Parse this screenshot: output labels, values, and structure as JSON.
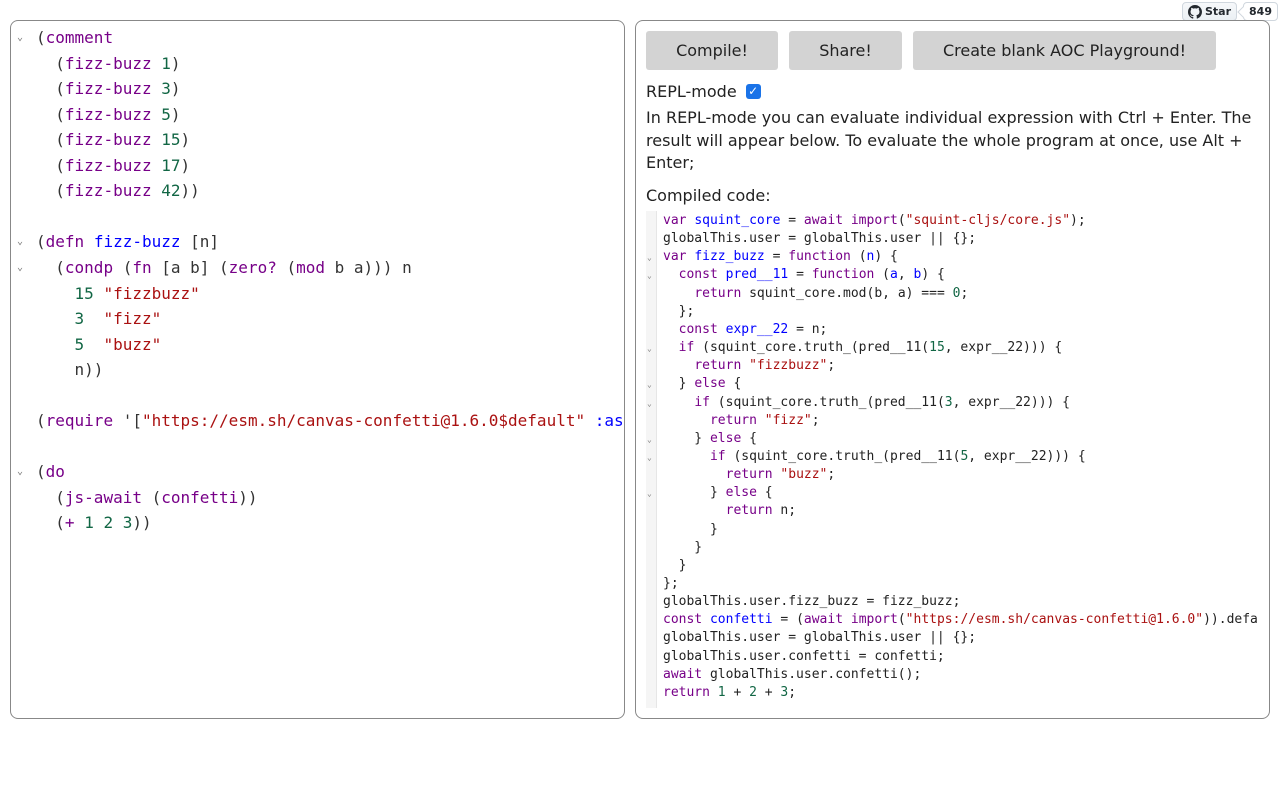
{
  "github": {
    "star_label": "Star",
    "star_count": "849"
  },
  "toolbar": {
    "compile_label": "Compile!",
    "share_label": "Share!",
    "aoc_label": "Create blank AOC Playground!"
  },
  "repl": {
    "label": "REPL-mode",
    "checked": true,
    "help_text": "In REPL-mode you can evaluate individual expression with Ctrl + Enter. The result will appear below. To evaluate the whole program at once, use Alt + Enter;"
  },
  "compiled_label": "Compiled code:",
  "source_lines": [
    {
      "fold": true,
      "tokens": [
        [
          "(",
          "paren"
        ],
        [
          "comment",
          "fn"
        ]
      ]
    },
    {
      "fold": false,
      "tokens": [
        [
          "  (",
          "paren"
        ],
        [
          "fizz-buzz",
          "fn"
        ],
        [
          " ",
          "plain"
        ],
        [
          "1",
          "num"
        ],
        [
          ")",
          "paren"
        ]
      ]
    },
    {
      "fold": false,
      "tokens": [
        [
          "  (",
          "paren"
        ],
        [
          "fizz-buzz",
          "fn"
        ],
        [
          " ",
          "plain"
        ],
        [
          "3",
          "num"
        ],
        [
          ")",
          "paren"
        ]
      ]
    },
    {
      "fold": false,
      "tokens": [
        [
          "  (",
          "paren"
        ],
        [
          "fizz-buzz",
          "fn"
        ],
        [
          " ",
          "plain"
        ],
        [
          "5",
          "num"
        ],
        [
          ")",
          "paren"
        ]
      ]
    },
    {
      "fold": false,
      "tokens": [
        [
          "  (",
          "paren"
        ],
        [
          "fizz-buzz",
          "fn"
        ],
        [
          " ",
          "plain"
        ],
        [
          "15",
          "num"
        ],
        [
          ")",
          "paren"
        ]
      ]
    },
    {
      "fold": false,
      "tokens": [
        [
          "  (",
          "paren"
        ],
        [
          "fizz-buzz",
          "fn"
        ],
        [
          " ",
          "plain"
        ],
        [
          "17",
          "num"
        ],
        [
          ")",
          "paren"
        ]
      ]
    },
    {
      "fold": false,
      "tokens": [
        [
          "  (",
          "paren"
        ],
        [
          "fizz-buzz",
          "fn"
        ],
        [
          " ",
          "plain"
        ],
        [
          "42",
          "num"
        ],
        [
          "))",
          "paren"
        ]
      ]
    },
    {
      "fold": false,
      "tokens": []
    },
    {
      "fold": true,
      "tokens": [
        [
          "(",
          "paren"
        ],
        [
          "defn",
          "fn"
        ],
        [
          " ",
          "plain"
        ],
        [
          "fizz-buzz",
          "def"
        ],
        [
          " [n]",
          "sym"
        ]
      ]
    },
    {
      "fold": true,
      "tokens": [
        [
          "  (",
          "paren"
        ],
        [
          "condp",
          "fn"
        ],
        [
          " (",
          "paren"
        ],
        [
          "fn",
          "fn"
        ],
        [
          " [a b] (",
          "sym"
        ],
        [
          "zero?",
          "fn"
        ],
        [
          " (",
          "paren"
        ],
        [
          "mod",
          "fn"
        ],
        [
          " b a))) n",
          "sym"
        ]
      ]
    },
    {
      "fold": false,
      "tokens": [
        [
          "    ",
          "plain"
        ],
        [
          "15",
          "num"
        ],
        [
          " ",
          "plain"
        ],
        [
          "\"fizzbuzz\"",
          "str"
        ]
      ]
    },
    {
      "fold": false,
      "tokens": [
        [
          "    ",
          "plain"
        ],
        [
          "3",
          "num"
        ],
        [
          "  ",
          "plain"
        ],
        [
          "\"fizz\"",
          "str"
        ]
      ]
    },
    {
      "fold": false,
      "tokens": [
        [
          "    ",
          "plain"
        ],
        [
          "5",
          "num"
        ],
        [
          "  ",
          "plain"
        ],
        [
          "\"buzz\"",
          "str"
        ]
      ]
    },
    {
      "fold": false,
      "tokens": [
        [
          "    n))",
          "sym"
        ]
      ]
    },
    {
      "fold": false,
      "tokens": []
    },
    {
      "fold": false,
      "tokens": [
        [
          "(",
          "paren"
        ],
        [
          "require",
          "fn"
        ],
        [
          " '[",
          "sym"
        ],
        [
          "\"https://esm.sh/canvas-confetti@1.6.0$default\"",
          "str"
        ],
        [
          " ",
          "plain"
        ],
        [
          ":as",
          "var"
        ]
      ]
    },
    {
      "fold": false,
      "tokens": []
    },
    {
      "fold": true,
      "tokens": [
        [
          "(",
          "paren"
        ],
        [
          "do",
          "fn"
        ]
      ]
    },
    {
      "fold": false,
      "tokens": [
        [
          "  (",
          "paren"
        ],
        [
          "js-await",
          "fn"
        ],
        [
          " (",
          "paren"
        ],
        [
          "confetti",
          "fn"
        ],
        [
          "))",
          "paren"
        ]
      ]
    },
    {
      "fold": false,
      "tokens": [
        [
          "  (",
          "paren"
        ],
        [
          "+",
          "fn"
        ],
        [
          " ",
          "plain"
        ],
        [
          "1",
          "num"
        ],
        [
          " ",
          "plain"
        ],
        [
          "2",
          "num"
        ],
        [
          " ",
          "plain"
        ],
        [
          "3",
          "num"
        ],
        [
          "))",
          "paren"
        ]
      ]
    }
  ],
  "compiled_lines": [
    {
      "fold": false,
      "tokens": [
        [
          "var",
          "kw"
        ],
        [
          " ",
          "plain"
        ],
        [
          "squint_core",
          "var"
        ],
        [
          " = ",
          "plain"
        ],
        [
          "await",
          "kw"
        ],
        [
          " ",
          "plain"
        ],
        [
          "import",
          "kw"
        ],
        [
          "(",
          "plain"
        ],
        [
          "\"squint-cljs/core.js\"",
          "str"
        ],
        [
          ");",
          "plain"
        ]
      ]
    },
    {
      "fold": false,
      "tokens": [
        [
          "globalThis.user = globalThis.user || {};",
          "plain"
        ]
      ]
    },
    {
      "fold": true,
      "tokens": [
        [
          "var",
          "kw"
        ],
        [
          " ",
          "plain"
        ],
        [
          "fizz_buzz",
          "var"
        ],
        [
          " = ",
          "plain"
        ],
        [
          "function",
          "kw"
        ],
        [
          " (",
          "plain"
        ],
        [
          "n",
          "var"
        ],
        [
          ") {",
          "plain"
        ]
      ]
    },
    {
      "fold": true,
      "tokens": [
        [
          "  ",
          "plain"
        ],
        [
          "const",
          "kw"
        ],
        [
          " ",
          "plain"
        ],
        [
          "pred__11",
          "var"
        ],
        [
          " = ",
          "plain"
        ],
        [
          "function",
          "kw"
        ],
        [
          " (",
          "plain"
        ],
        [
          "a",
          "var"
        ],
        [
          ", ",
          "plain"
        ],
        [
          "b",
          "var"
        ],
        [
          ") {",
          "plain"
        ]
      ]
    },
    {
      "fold": false,
      "tokens": [
        [
          "    ",
          "plain"
        ],
        [
          "return",
          "kw"
        ],
        [
          " squint_core.mod(b, a) === ",
          "plain"
        ],
        [
          "0",
          "num"
        ],
        [
          ";",
          "plain"
        ]
      ]
    },
    {
      "fold": false,
      "tokens": [
        [
          "  };",
          "plain"
        ]
      ]
    },
    {
      "fold": false,
      "tokens": [
        [
          "  ",
          "plain"
        ],
        [
          "const",
          "kw"
        ],
        [
          " ",
          "plain"
        ],
        [
          "expr__22",
          "var"
        ],
        [
          " = n;",
          "plain"
        ]
      ]
    },
    {
      "fold": true,
      "tokens": [
        [
          "  ",
          "plain"
        ],
        [
          "if",
          "kw"
        ],
        [
          " (squint_core.truth_(pred__11(",
          "plain"
        ],
        [
          "15",
          "num"
        ],
        [
          ", expr__22))) {",
          "plain"
        ]
      ]
    },
    {
      "fold": false,
      "tokens": [
        [
          "    ",
          "plain"
        ],
        [
          "return",
          "kw"
        ],
        [
          " ",
          "plain"
        ],
        [
          "\"fizzbuzz\"",
          "str"
        ],
        [
          ";",
          "plain"
        ]
      ]
    },
    {
      "fold": true,
      "tokens": [
        [
          "  } ",
          "plain"
        ],
        [
          "else",
          "kw"
        ],
        [
          " {",
          "plain"
        ]
      ]
    },
    {
      "fold": true,
      "tokens": [
        [
          "    ",
          "plain"
        ],
        [
          "if",
          "kw"
        ],
        [
          " (squint_core.truth_(pred__11(",
          "plain"
        ],
        [
          "3",
          "num"
        ],
        [
          ", expr__22))) {",
          "plain"
        ]
      ]
    },
    {
      "fold": false,
      "tokens": [
        [
          "      ",
          "plain"
        ],
        [
          "return",
          "kw"
        ],
        [
          " ",
          "plain"
        ],
        [
          "\"fizz\"",
          "str"
        ],
        [
          ";",
          "plain"
        ]
      ]
    },
    {
      "fold": true,
      "tokens": [
        [
          "    } ",
          "plain"
        ],
        [
          "else",
          "kw"
        ],
        [
          " {",
          "plain"
        ]
      ]
    },
    {
      "fold": true,
      "tokens": [
        [
          "      ",
          "plain"
        ],
        [
          "if",
          "kw"
        ],
        [
          " (squint_core.truth_(pred__11(",
          "plain"
        ],
        [
          "5",
          "num"
        ],
        [
          ", expr__22))) {",
          "plain"
        ]
      ]
    },
    {
      "fold": false,
      "tokens": [
        [
          "        ",
          "plain"
        ],
        [
          "return",
          "kw"
        ],
        [
          " ",
          "plain"
        ],
        [
          "\"buzz\"",
          "str"
        ],
        [
          ";",
          "plain"
        ]
      ]
    },
    {
      "fold": true,
      "tokens": [
        [
          "      } ",
          "plain"
        ],
        [
          "else",
          "kw"
        ],
        [
          " {",
          "plain"
        ]
      ]
    },
    {
      "fold": false,
      "tokens": [
        [
          "        ",
          "plain"
        ],
        [
          "return",
          "kw"
        ],
        [
          " n;",
          "plain"
        ]
      ]
    },
    {
      "fold": false,
      "tokens": [
        [
          "      }",
          "plain"
        ]
      ]
    },
    {
      "fold": false,
      "tokens": [
        [
          "    }",
          "plain"
        ]
      ]
    },
    {
      "fold": false,
      "tokens": [
        [
          "  }",
          "plain"
        ]
      ]
    },
    {
      "fold": false,
      "tokens": [
        [
          "};",
          "plain"
        ]
      ]
    },
    {
      "fold": false,
      "tokens": [
        [
          "globalThis.user.fizz_buzz = fizz_buzz;",
          "plain"
        ]
      ]
    },
    {
      "fold": false,
      "tokens": [
        [
          "const",
          "kw"
        ],
        [
          " ",
          "plain"
        ],
        [
          "confetti",
          "var"
        ],
        [
          " = (",
          "plain"
        ],
        [
          "await",
          "kw"
        ],
        [
          " ",
          "plain"
        ],
        [
          "import",
          "kw"
        ],
        [
          "(",
          "plain"
        ],
        [
          "\"https://esm.sh/canvas-confetti@1.6.0\"",
          "str"
        ],
        [
          ")).defa",
          "plain"
        ]
      ]
    },
    {
      "fold": false,
      "tokens": [
        [
          "globalThis.user = globalThis.user || {};",
          "plain"
        ]
      ]
    },
    {
      "fold": false,
      "tokens": [
        [
          "globalThis.user.confetti = confetti;",
          "plain"
        ]
      ]
    },
    {
      "fold": false,
      "tokens": [
        [
          "await",
          "kw"
        ],
        [
          " globalThis.user.confetti();",
          "plain"
        ]
      ]
    },
    {
      "fold": false,
      "tokens": [
        [
          "return",
          "kw"
        ],
        [
          " ",
          "plain"
        ],
        [
          "1",
          "num"
        ],
        [
          " + ",
          "plain"
        ],
        [
          "2",
          "num"
        ],
        [
          " + ",
          "plain"
        ],
        [
          "3",
          "num"
        ],
        [
          ";",
          "plain"
        ]
      ]
    }
  ]
}
